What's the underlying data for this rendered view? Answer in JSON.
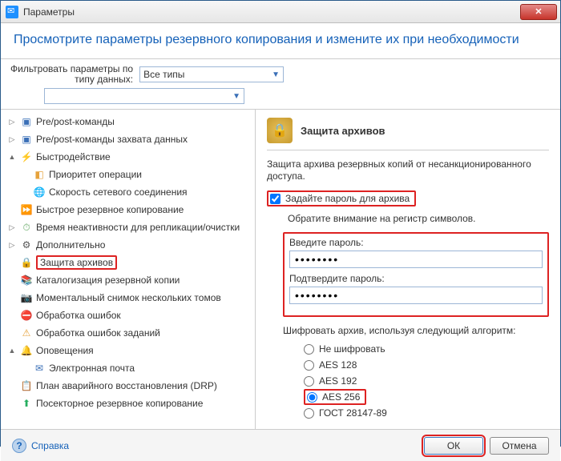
{
  "window": {
    "title": "Параметры"
  },
  "header": {
    "title": "Просмотрите параметры резервного копирования и измените их при необходимости"
  },
  "filter": {
    "label": "Фильтровать параметры по\nтипу данных:",
    "type_value": "Все типы",
    "second_value": ""
  },
  "tree": {
    "items": [
      {
        "label": "Pre/post-команды",
        "icon": "cmd",
        "level": 0,
        "exp": "▷"
      },
      {
        "label": "Pre/post-команды захвата данных",
        "icon": "cmd",
        "level": 0,
        "exp": "▷"
      },
      {
        "label": "Быстродействие",
        "icon": "speed",
        "level": 0,
        "exp": "▲"
      },
      {
        "label": "Приоритет операции",
        "icon": "prio",
        "level": 1
      },
      {
        "label": "Скорость сетевого соединения",
        "icon": "net",
        "level": 1
      },
      {
        "label": "Быстрое резервное копирование",
        "icon": "fast",
        "level": 0
      },
      {
        "label": "Время неактивности для репликации/очистки",
        "icon": "time",
        "level": 0,
        "exp": "▷"
      },
      {
        "label": "Дополнительно",
        "icon": "more",
        "level": 0,
        "exp": "▷"
      },
      {
        "label": "Защита архивов",
        "icon": "lock",
        "level": 0,
        "selected": true
      },
      {
        "label": "Каталогизация резервной копии",
        "icon": "book",
        "level": 0
      },
      {
        "label": "Моментальный снимок нескольких томов",
        "icon": "snap",
        "level": 0
      },
      {
        "label": "Обработка ошибок",
        "icon": "err",
        "level": 0
      },
      {
        "label": "Обработка ошибок заданий",
        "icon": "task",
        "level": 0
      },
      {
        "label": "Оповещения",
        "icon": "bell",
        "level": 0,
        "exp": "▲"
      },
      {
        "label": "Электронная почта",
        "icon": "mail",
        "level": 1
      },
      {
        "label": "План аварийного восстановления (DRP)",
        "icon": "drp",
        "level": 0
      },
      {
        "label": "Посекторное резервное копирование",
        "icon": "sector",
        "level": 0
      }
    ]
  },
  "panel": {
    "title": "Защита архивов",
    "description": "Защита архива резервных копий от несанкционированного доступа.",
    "checkbox_label": "Задайте пароль для архива",
    "checkbox_checked": true,
    "hint": "Обратите внимание на регистр символов.",
    "pw_label": "Введите пароль:",
    "pw_value": "●●●●●●●●",
    "pw2_label": "Подтвердите пароль:",
    "pw2_value": "●●●●●●●●",
    "algo_label": "Шифровать архив, используя следующий алгоритм:",
    "radios": [
      {
        "label": "Не шифровать",
        "checked": false
      },
      {
        "label": "AES 128",
        "checked": false
      },
      {
        "label": "AES 192",
        "checked": false
      },
      {
        "label": "AES 256",
        "checked": true,
        "highlight": true
      },
      {
        "label": "ГОСТ 28147-89",
        "checked": false
      }
    ]
  },
  "footer": {
    "help": "Справка",
    "ok": "ОК",
    "cancel": "Отмена"
  }
}
